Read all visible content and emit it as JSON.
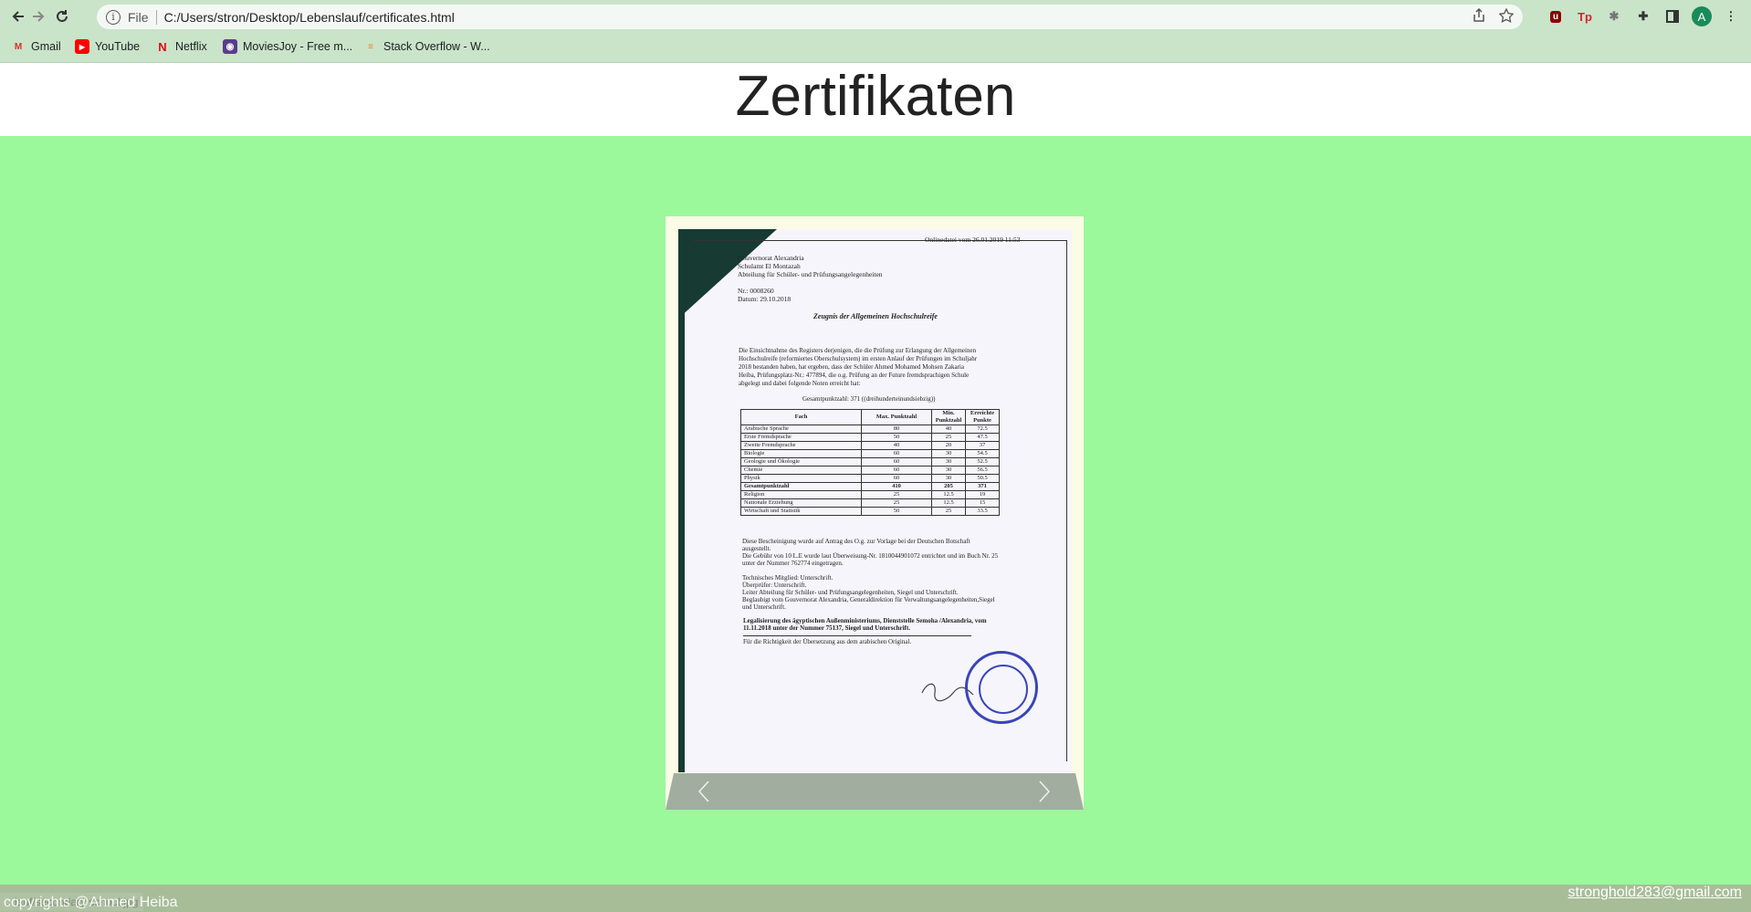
{
  "browser": {
    "url_scheme": "File",
    "url": "C:/Users/stron/Desktop/Lebenslauf/certificates.html",
    "profile_initial": "A",
    "bookmarks": [
      {
        "label": "Gmail",
        "icon": "gmail-icon"
      },
      {
        "label": "YouTube",
        "icon": "youtube-icon"
      },
      {
        "label": "Netflix",
        "icon": "netflix-icon"
      },
      {
        "label": "MoviesJoy - Free m...",
        "icon": "moviesjoy-icon"
      },
      {
        "label": "Stack Overflow - W...",
        "icon": "stackoverflow-icon"
      }
    ]
  },
  "page": {
    "title": "Zertifikate n",
    "heading": "Zertifikaten",
    "footer_copyright": "copyrights @Ahmed Heiba",
    "footer_email": "stronghold283@gmail.com",
    "status_url": "...lauf/secondary school.jpg"
  },
  "certificate": {
    "online_note": "Onlinedatei vom 26.01.2019 11:53",
    "authority_lines": [
      "Gouvernorat Alexandria",
      "Schulamt El Montazah",
      "Abteilung für Schüler- und Prüfungsangelegenheiten"
    ],
    "number": "Nr.: 0008260",
    "date": "Datum: 29.10.2018",
    "title": "Zeugnis der Allgemeinen Hochschulreife",
    "body_lines": [
      "Die Einsichtnahme des Registers derjenigen, die die Prüfung zur Erlangung der Allgemeinen",
      "Hochschulreife (reformiertes Oberschulsystem) im ersten Anlauf der Prüfungen im Schuljahr",
      "2018 bestanden haben, hat ergeben, dass der Schüler Ahmed Mohamed Mohsen Zakaria",
      "Heiba, Prüfungsplatz-Nr.: 477894, die o.g. Prüfung an der Future fremdsprachigen Schule",
      "abgelegt und dabei folgende Noten erreicht hat:"
    ],
    "total_line": "Gesamtpunktzahl: 371 ((dreihunderteinundsiebzig))",
    "table_headers": [
      "Fach",
      "Max. Punktzahl",
      "Min. Punktzahl",
      "Erreichte Punkte"
    ],
    "table_rows": [
      [
        "Arabische Sprache",
        "80",
        "40",
        "72.5"
      ],
      [
        "Erste Fremdsprache",
        "50",
        "25",
        "47.5"
      ],
      [
        "Zweite Fremdsprache",
        "40",
        "20",
        "37"
      ],
      [
        "Biologie",
        "60",
        "30",
        "54.5"
      ],
      [
        "Geologie und Ökologie",
        "60",
        "30",
        "52.5"
      ],
      [
        "Chemie",
        "60",
        "30",
        "56.5"
      ],
      [
        "Physik",
        "60",
        "30",
        "50.5"
      ],
      [
        "Gesamtpunktzahl",
        "410",
        "205",
        "371"
      ],
      [
        "Religion",
        "25",
        "12.5",
        "19"
      ],
      [
        "Nationale Erziehung",
        "25",
        "12.5",
        "15"
      ],
      [
        "Wirtschaft und Statistik",
        "50",
        "25",
        "33.5"
      ]
    ],
    "lower_lines": [
      "Diese Bescheinigung wurde auf Antrag des O.g. zur Vorlage bei der Deutschen Botschaft",
      "ausgestellt.",
      "Die Gebühr von 10 L.E wurde laut Überweisung-Nr. 1810044901072 entrichtet und im Buch Nr. 25",
      "unter der Nummer 762774 eingetragen."
    ],
    "signature_lines": [
      "Technisches Mitglied: Unterschrift.",
      "Überprüfer: Unterschrift.",
      "Leiter Abteilung für Schüler- und Prüfungsangelegenheiten, Siegel und Unterschrift.",
      "Beglaubigt vom Gouvernorat Alexandria, Generaldirektion für Verwaltungsangelegenheiten,Siegel",
      "und Unterschrift."
    ],
    "legalization_lines": [
      "Legalisierung des ägyptischen Außenministeriums, Dienststelle Semoha /Alexandria, vom",
      "11.11.2018 unter der Nummer 75137, Siegel und Unterschrift."
    ],
    "translation_note": "Für die Richtigkeit der Übersetzung aus dem arabischen Original."
  },
  "colors": {
    "page_bg": "#9bf89b",
    "footer_bg": "#a7bd98",
    "caption_bg": "#a1ae9f",
    "stamp": "#3945b8"
  }
}
